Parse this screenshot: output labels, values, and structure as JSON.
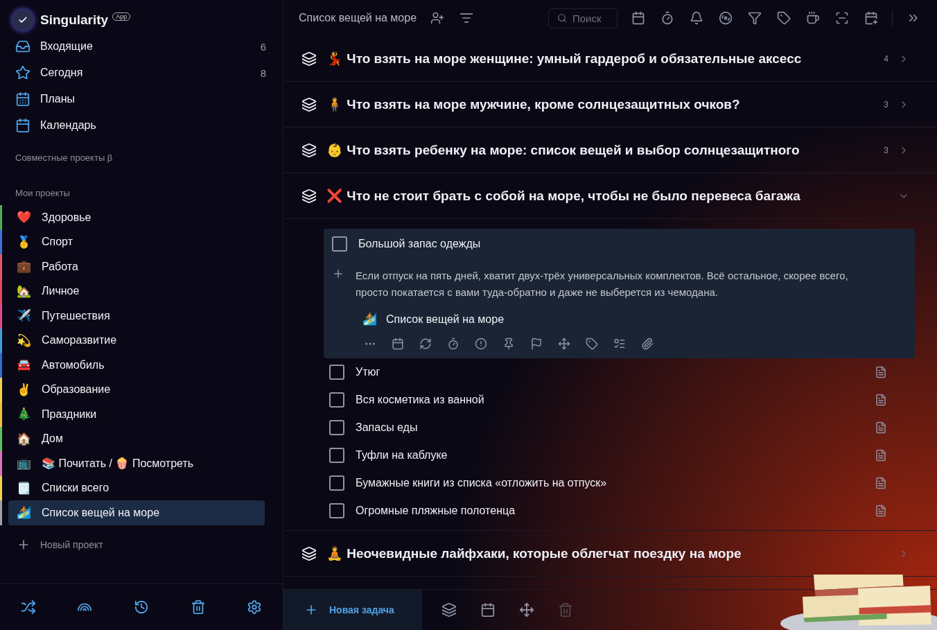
{
  "app": {
    "name": "Singularity",
    "badge": "App"
  },
  "nav": [
    {
      "label": "Входящие",
      "count": "6"
    },
    {
      "label": "Сегодня",
      "count": "8"
    },
    {
      "label": "Планы"
    },
    {
      "label": "Календарь"
    }
  ],
  "shared_heading": "Совместные проекты β",
  "projects_heading": "Мои проекты",
  "projects": [
    {
      "emoji": "❤️",
      "label": "Здоровье",
      "color": "#4caf50",
      "selected": false
    },
    {
      "emoji": "🥇",
      "label": "Спорт",
      "color": "#3f6fd8",
      "selected": false
    },
    {
      "emoji": "💼",
      "label": "Работа",
      "color": "#e0566b",
      "selected": false
    },
    {
      "emoji": "🏡",
      "label": "Личное",
      "color": "#e04a5a",
      "selected": false
    },
    {
      "emoji": "✈️",
      "label": "Путешествия",
      "color": "#e04a8a",
      "selected": false
    },
    {
      "emoji": "💫",
      "label": "Саморазвитие",
      "color": "#3aa0e0",
      "selected": false
    },
    {
      "emoji": "🚘",
      "label": "Автомобиль",
      "color": "#2f6fd0",
      "selected": false
    },
    {
      "emoji": "✌️",
      "label": "Образование",
      "color": "#f2d34a",
      "selected": false
    },
    {
      "emoji": "🎄",
      "label": "Праздники",
      "color": "#f2c040",
      "selected": false
    },
    {
      "emoji": "🏠",
      "label": "Дом",
      "color": "#5cc45c",
      "selected": false
    },
    {
      "emoji": "📺",
      "label": "📚 Почитать / 🍿 Посмотреть",
      "color": "#e070c0",
      "selected": false
    },
    {
      "emoji": "🗒️",
      "label": "Списки всего",
      "color": "#f2d34a",
      "selected": false
    },
    {
      "emoji": "🏄",
      "label": "Список вещей на море",
      "color": "#9aa0aa",
      "selected": true
    }
  ],
  "new_project": "Новый проект",
  "header": {
    "title": "Список вещей на море",
    "search_placeholder": "Поиск"
  },
  "groups": [
    {
      "emoji": "💃",
      "title": "Что взять на море женщине: умный гардероб и обязательные аксесс",
      "count": "4",
      "expanded": false
    },
    {
      "emoji": "🧍",
      "title": "Что взять на море мужчине, кроме солнцезащитных очков?",
      "count": "3",
      "expanded": false
    },
    {
      "emoji": "👶",
      "title": "Что взять ребенку на море: список вещей и выбор солнцезащитного",
      "count": "3",
      "expanded": false
    },
    {
      "emoji": "❌",
      "title": "Что не стоит брать с собой на море, чтобы не было перевеса багажа",
      "expanded": true,
      "tasks": [
        {
          "title": "Большой запас одежды",
          "checked": false,
          "expanded": true,
          "note": "Если отпуск на пять дней, хватит двух-трёх универсальных комплектов. Всё остальное, скорее всего, просто покатается с вами туда-обратно и даже не выберется из чемодана.",
          "project_emoji": "🏄",
          "project": "Список вещей на море"
        },
        {
          "title": "Утюг",
          "checked": false,
          "expanded": false
        },
        {
          "title": "Вся косметика из ванной",
          "checked": false,
          "expanded": false
        },
        {
          "title": "Запасы еды",
          "checked": false,
          "expanded": false
        },
        {
          "title": "Туфли на каблуке",
          "checked": false,
          "expanded": false
        },
        {
          "title": "Бумажные книги из списка «отложить на отпуск»",
          "checked": false,
          "expanded": false
        },
        {
          "title": "Огромные пляжные полотенца",
          "checked": false,
          "expanded": false
        }
      ]
    },
    {
      "emoji": "🧘",
      "title": "Неочевидные лайфхаки, которые облегчат поездку на море",
      "expanded": false
    }
  ],
  "new_task": "Новая задача"
}
